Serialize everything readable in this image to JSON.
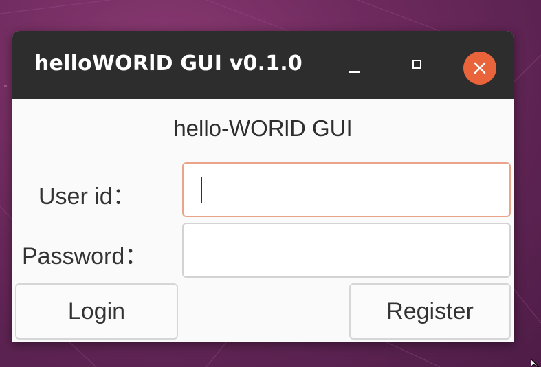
{
  "window": {
    "title": "helloWORlD GUI v0.1.0",
    "controls": {
      "minimize_icon": "minimize-icon",
      "maximize_icon": "maximize-icon",
      "close_icon": "close-icon"
    }
  },
  "form": {
    "heading": "hello-WORlD GUI",
    "user_id_label": "User id：",
    "user_id_value": "",
    "password_label": "Password：",
    "password_value": ""
  },
  "buttons": {
    "login": "Login",
    "register": "Register"
  },
  "colors": {
    "desktop_background": "#6e2a5e",
    "titlebar": "#2d2d2d",
    "close_button": "#e9643a",
    "focused_field_border": "#e9a48a",
    "window_background": "#fafafa"
  }
}
